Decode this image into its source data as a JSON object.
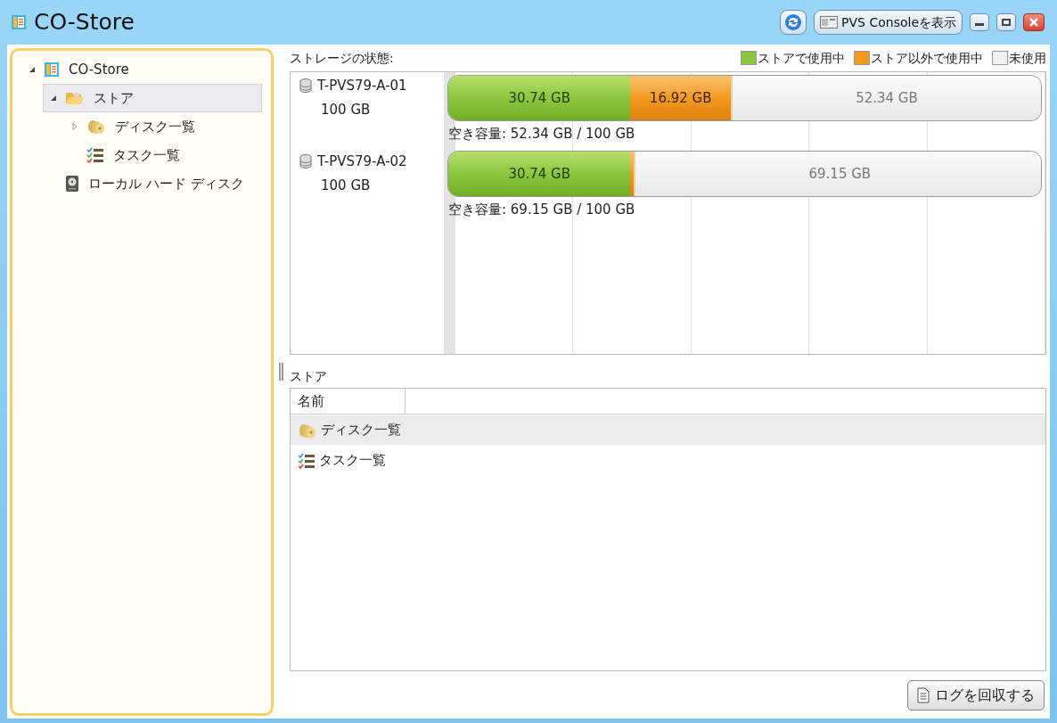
{
  "window": {
    "title": "CO-Store",
    "console_button": "PVS Consoleを表示"
  },
  "tree": [
    {
      "label": "CO-Store",
      "kind": "root",
      "expanded": true,
      "selected": false,
      "children": [
        {
          "label": "ストア",
          "kind": "folder",
          "expanded": true,
          "selected": true,
          "children": [
            {
              "label": "ディスク一覧",
              "kind": "disks",
              "expanded": false,
              "selected": false
            },
            {
              "label": "タスク一覧",
              "kind": "tasks",
              "selected": false
            }
          ]
        },
        {
          "label": "ローカル ハード ディスク",
          "kind": "hdd",
          "selected": false
        }
      ]
    }
  ],
  "storage": {
    "title": "ストレージの状態:",
    "legend": [
      {
        "label": "ストアで使用中",
        "color": "#8cc63f"
      },
      {
        "label": "ストア以外で使用中",
        "color": "#f39a1e"
      },
      {
        "label": "未使用",
        "color": "#f2f2f2"
      }
    ],
    "disks": [
      {
        "name": "T-PVS79-A-01",
        "size": "100 GB",
        "free": "空き容量: 52.34 GB / 100 GB",
        "segments": [
          {
            "kind": "store",
            "level": 0.3074,
            "label": "30.74 GB"
          },
          {
            "kind": "other",
            "label": "16.92 GB"
          },
          {
            "kind": "free",
            "level": 0.5234,
            "label": "52.34 GB"
          }
        ]
      },
      {
        "name": "T-PVS79-A-02",
        "size": "100 GB",
        "free": "空き容量: 69.15 GB / 100 GB",
        "segments": [
          {
            "kind": "store",
            "level": 0.3074,
            "label": "30.74 GB"
          },
          {
            "kind": "other"
          },
          {
            "kind": "free",
            "level": 0.6915,
            "label": "69.15 GB"
          }
        ]
      }
    ]
  },
  "store_panel": {
    "title": "ストア",
    "columns": [
      "名前"
    ],
    "rows": [
      {
        "name": "ディスク一覧",
        "kind": "disks",
        "selected": true
      },
      {
        "name": "タスク一覧",
        "kind": "tasks",
        "selected": false
      }
    ]
  },
  "footer": {
    "button": "ログを回収する"
  }
}
